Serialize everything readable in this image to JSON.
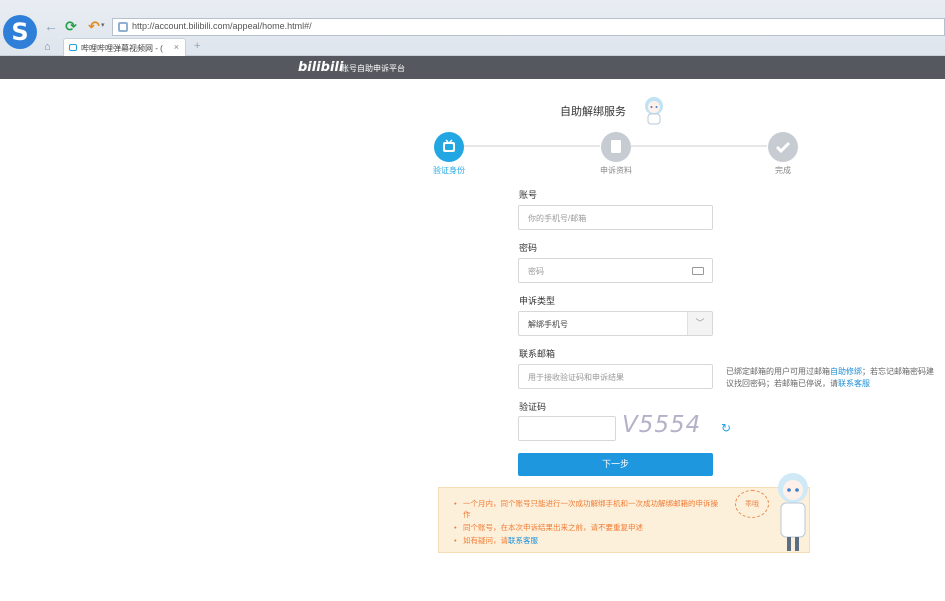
{
  "browser": {
    "url": "http://account.bilibili.com/appeal/home.html#/",
    "tab_title": "哔哩哔哩弹幕视频网 - (",
    "tab_close": "×",
    "new_tab": "+"
  },
  "header": {
    "logo": "bilibili",
    "title": "账号自助申诉平台"
  },
  "page": {
    "service_title": "自助解绑服务"
  },
  "steps": [
    {
      "label": "验证身份",
      "active": true
    },
    {
      "label": "申诉资料",
      "active": false
    },
    {
      "label": "完成",
      "active": false
    }
  ],
  "form": {
    "account_label": "账号",
    "account_placeholder": "你的手机号/邮箱",
    "password_label": "密码",
    "password_placeholder": "密码",
    "appeal_type_label": "申诉类型",
    "appeal_type_value": "解绑手机号",
    "email_label": "联系邮箱",
    "email_placeholder": "用于接收验证码和申诉结果",
    "email_hint_part1": "已绑定邮箱的用户可用过邮箱",
    "email_hint_link1": "自助修绑",
    "email_hint_part2": "；若忘记邮箱密码建议找回密码；若邮箱已停说，请",
    "email_hint_link2": "联系客服",
    "captcha_label": "验证码",
    "captcha_text": "V5554",
    "next_button": "下一步"
  },
  "notice": {
    "items": [
      "一个月内，同个账号只能进行一次成功解绑手机和一次成功解绑邮箱的申诉操作",
      "同个账号，在本次申诉结果出来之前，请不要重复申述"
    ],
    "help_text": "如有疑问，请",
    "help_link": "联系客服",
    "bubble": "乖哦"
  }
}
